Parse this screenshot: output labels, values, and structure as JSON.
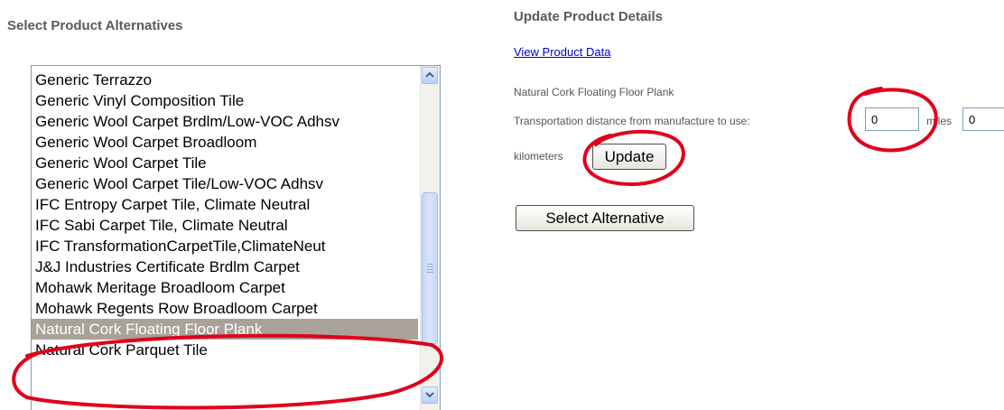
{
  "left_heading": "Select Product Alternatives",
  "right_heading": "Update Product Details",
  "products": [
    "Generic Terrazzo",
    "Generic Vinyl Composition Tile",
    "Generic Wool Carpet Brdlm/Low-VOC Adhsv",
    "Generic Wool Carpet Broadloom",
    "Generic Wool Carpet Tile",
    "Generic Wool Carpet Tile/Low-VOC Adhsv",
    "IFC Entropy Carpet Tile, Climate Neutral",
    "IFC Sabi Carpet Tile, Climate Neutral",
    "IFC TransformationCarpetTile,ClimateNeut",
    "J&J Industries Certificate Brdlm Carpet",
    "Mohawk Meritage Broadloom Carpet",
    "Mohawk Regents Row Broadloom Carpet",
    "Natural Cork Floating Floor Plank",
    "Natural Cork Parquet Tile"
  ],
  "selected_product": "Natural Cork Floating Floor Plank",
  "details": {
    "view_link": "View Product Data",
    "product_name": "Natural Cork Floating Floor Plank",
    "distance_label": "Transportation distance from manufacture to use:",
    "distance_value": "0",
    "miles_label": "miles",
    "km_value": "0",
    "km_label": "kilometers",
    "update_button": "Update",
    "select_button": "Select Alternative"
  },
  "colors": {
    "annotation": "#e0001a",
    "selection": "#a8a29a",
    "link": "#0000cc"
  },
  "icons": {
    "scroll_up": "chevron-up-icon",
    "scroll_down": "chevron-down-icon"
  }
}
